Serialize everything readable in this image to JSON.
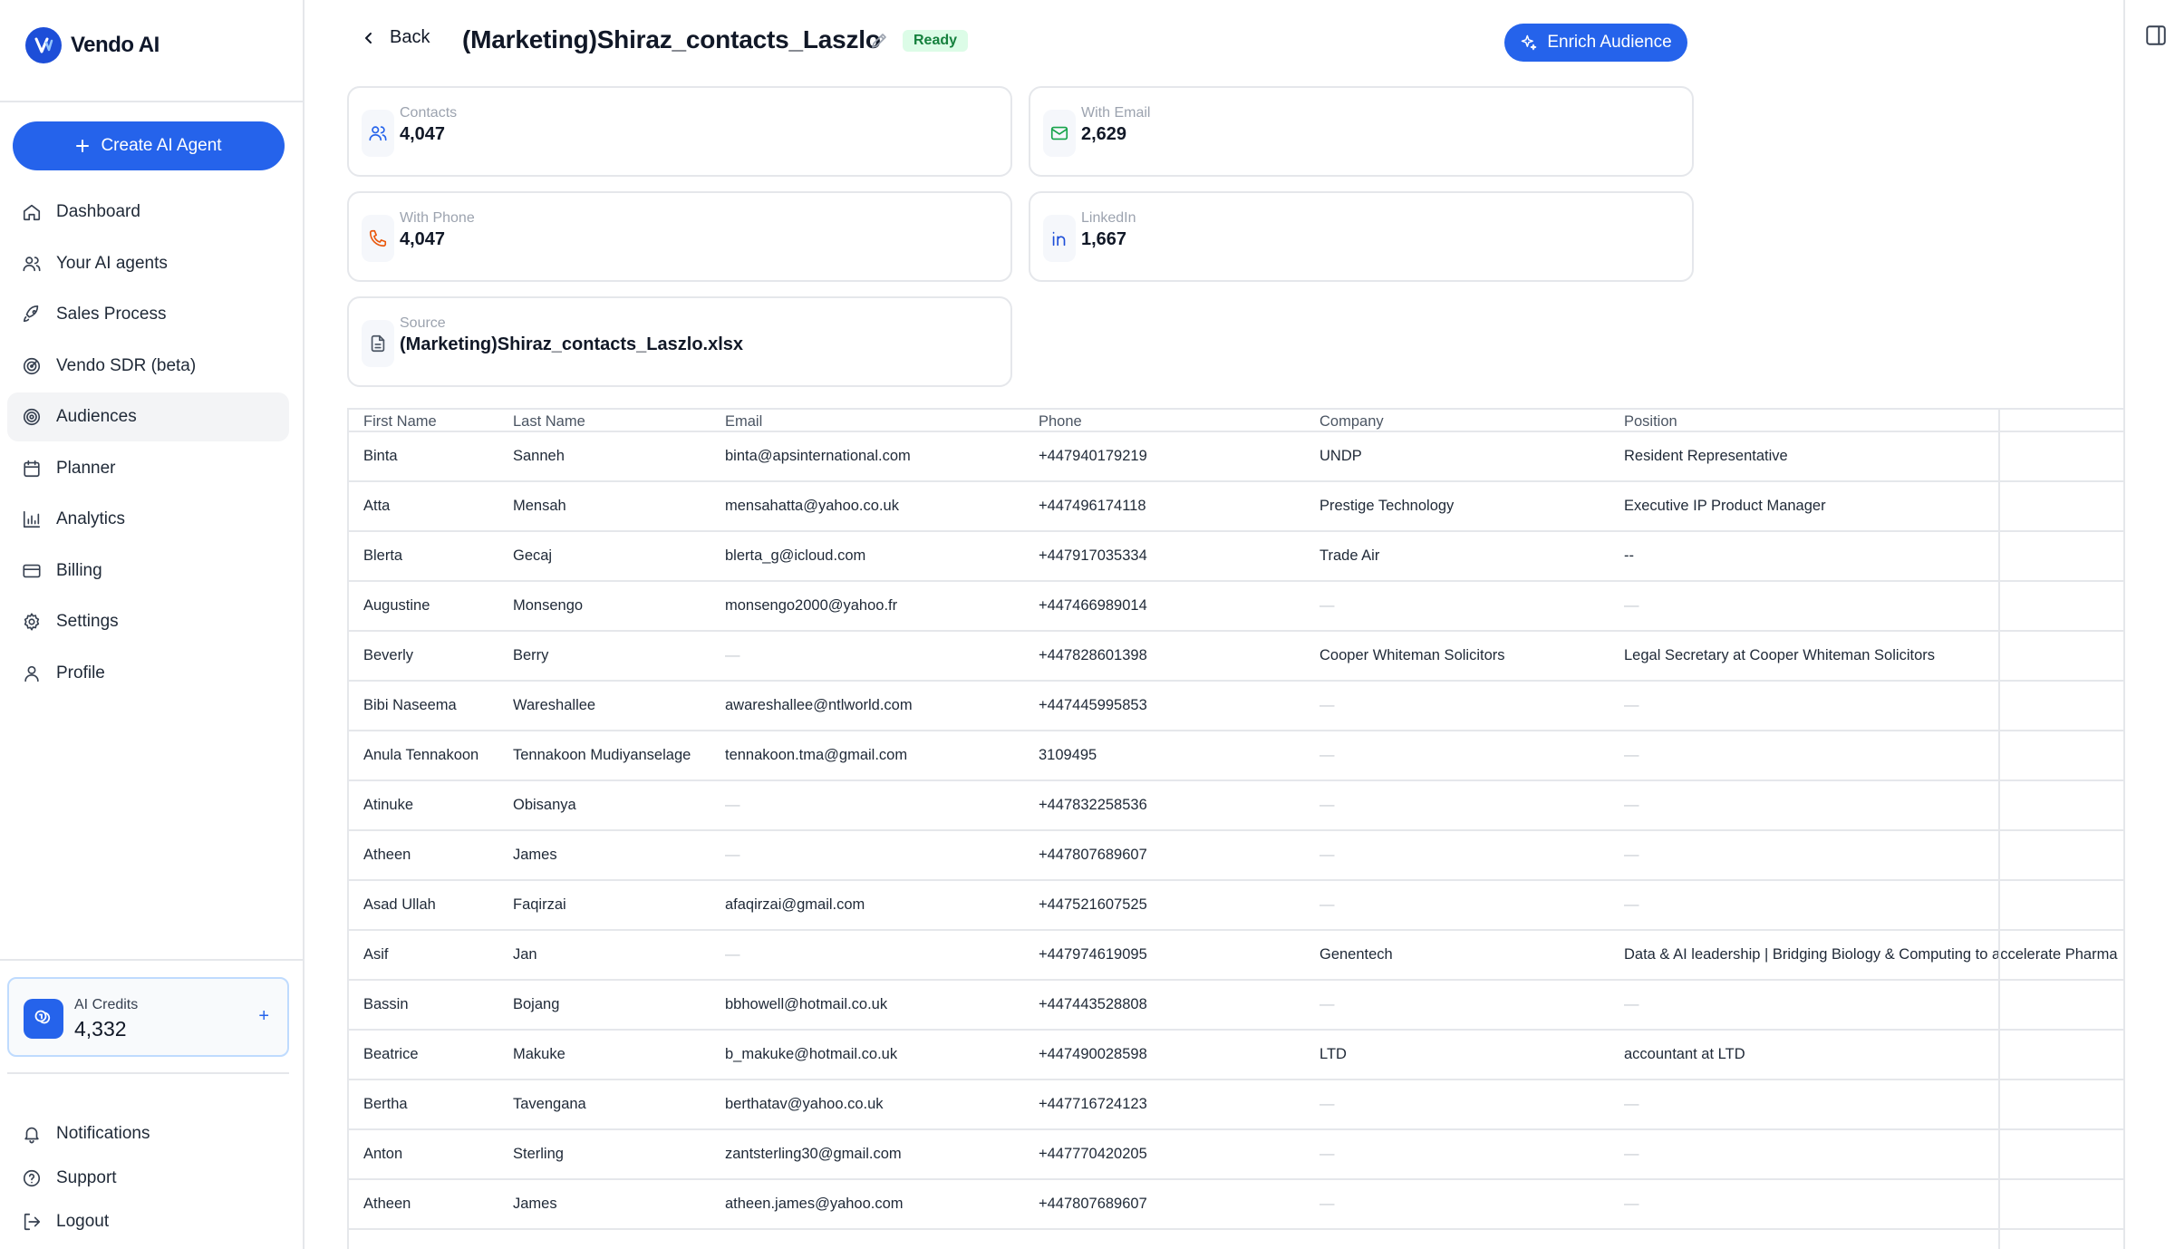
{
  "brand": {
    "name": "Vendo AI"
  },
  "sidebar": {
    "create_label": "Create AI Agent",
    "items": [
      {
        "label": "Dashboard",
        "icon": "home-icon"
      },
      {
        "label": "Your AI agents",
        "icon": "users-icon"
      },
      {
        "label": "Sales Process",
        "icon": "rocket-icon"
      },
      {
        "label": "Vendo SDR (beta)",
        "icon": "radar-icon"
      },
      {
        "label": "Audiences",
        "icon": "target-icon",
        "active": true
      },
      {
        "label": "Planner",
        "icon": "calendar-icon"
      },
      {
        "label": "Analytics",
        "icon": "bar-chart-icon"
      },
      {
        "label": "Billing",
        "icon": "credit-card-icon"
      },
      {
        "label": "Settings",
        "icon": "gear-icon"
      },
      {
        "label": "Profile",
        "icon": "user-icon"
      }
    ],
    "credits": {
      "label": "AI Credits",
      "value": "4,332"
    },
    "bottom_items": [
      {
        "label": "Notifications",
        "icon": "bell-icon"
      },
      {
        "label": "Support",
        "icon": "help-circle-icon"
      },
      {
        "label": "Logout",
        "icon": "logout-icon"
      }
    ]
  },
  "header": {
    "back_label": "Back",
    "title": "(Marketing)Shiraz_contacts_Laszlo",
    "status": "Ready",
    "enrich_label": "Enrich Audience"
  },
  "stats": {
    "contacts": {
      "label": "Contacts",
      "value": "4,047"
    },
    "with_email": {
      "label": "With Email",
      "value": "2,629"
    },
    "with_phone": {
      "label": "With Phone",
      "value": "4,047"
    },
    "linkedin": {
      "label": "LinkedIn",
      "value": "1,667"
    },
    "source": {
      "label": "Source",
      "value": "(Marketing)Shiraz_contacts_Laszlo.xlsx"
    }
  },
  "colors": {
    "accent": "#2563eb",
    "status_bg": "#dcfce7",
    "status_text": "#15803d",
    "email_icon": "#16a34a",
    "phone_icon": "#ea580c",
    "linkedin_icon": "#1d4ed8"
  },
  "table": {
    "columns": [
      "First Name",
      "Last Name",
      "Email",
      "Phone",
      "Company",
      "Position"
    ],
    "rows": [
      [
        "Binta",
        "Sanneh",
        "binta@apsinternational.com",
        "+447940179219",
        "UNDP",
        "Resident Representative"
      ],
      [
        "Atta",
        "Mensah",
        "mensahatta@yahoo.co.uk",
        "+447496174118",
        "Prestige Technology",
        "Executive IP Product Manager"
      ],
      [
        "Blerta",
        "Gecaj",
        "blerta_g@icloud.com",
        "+447917035334",
        "Trade Air",
        "--"
      ],
      [
        "Augustine",
        "Monsengo",
        "monsengo2000@yahoo.fr",
        "+447466989014",
        "—",
        "—"
      ],
      [
        "Beverly",
        "Berry",
        "—",
        "+447828601398",
        "Cooper Whiteman Solicitors",
        "Legal Secretary at Cooper Whiteman Solicitors"
      ],
      [
        "Bibi Naseema",
        "Wareshallee",
        "awareshallee@ntlworld.com",
        "+447445995853",
        "—",
        "—"
      ],
      [
        "Anula Tennakoon",
        "Tennakoon Mudiyanselage",
        "tennakoon.tma@gmail.com",
        "3109495",
        "—",
        "—"
      ],
      [
        "Atinuke",
        "Obisanya",
        "—",
        "+447832258536",
        "—",
        "—"
      ],
      [
        "Atheen",
        "James",
        "—",
        "+447807689607",
        "—",
        "—"
      ],
      [
        "Asad Ullah",
        "Faqirzai",
        "afaqirzai@gmail.com",
        "+447521607525",
        "—",
        "—"
      ],
      [
        "Asif",
        "Jan",
        "—",
        "+447974619095",
        "Genentech",
        "Data & AI leadership | Bridging Biology & Computing to accelerate Pharma"
      ],
      [
        "Bassin",
        "Bojang",
        "bbhowell@hotmail.co.uk",
        "+447443528808",
        "—",
        "—"
      ],
      [
        "Beatrice",
        "Makuke",
        "b_makuke@hotmail.co.uk",
        "+447490028598",
        "LTD",
        "accountant at LTD"
      ],
      [
        "Bertha",
        "Tavengana",
        "berthatav@yahoo.co.uk",
        "+447716724123",
        "—",
        "—"
      ],
      [
        "Anton",
        "Sterling",
        "zantsterling30@gmail.com",
        "+447770420205",
        "—",
        "—"
      ],
      [
        "Atheen",
        "James",
        "atheen.james@yahoo.com",
        "+447807689607",
        "—",
        "—"
      ]
    ]
  }
}
